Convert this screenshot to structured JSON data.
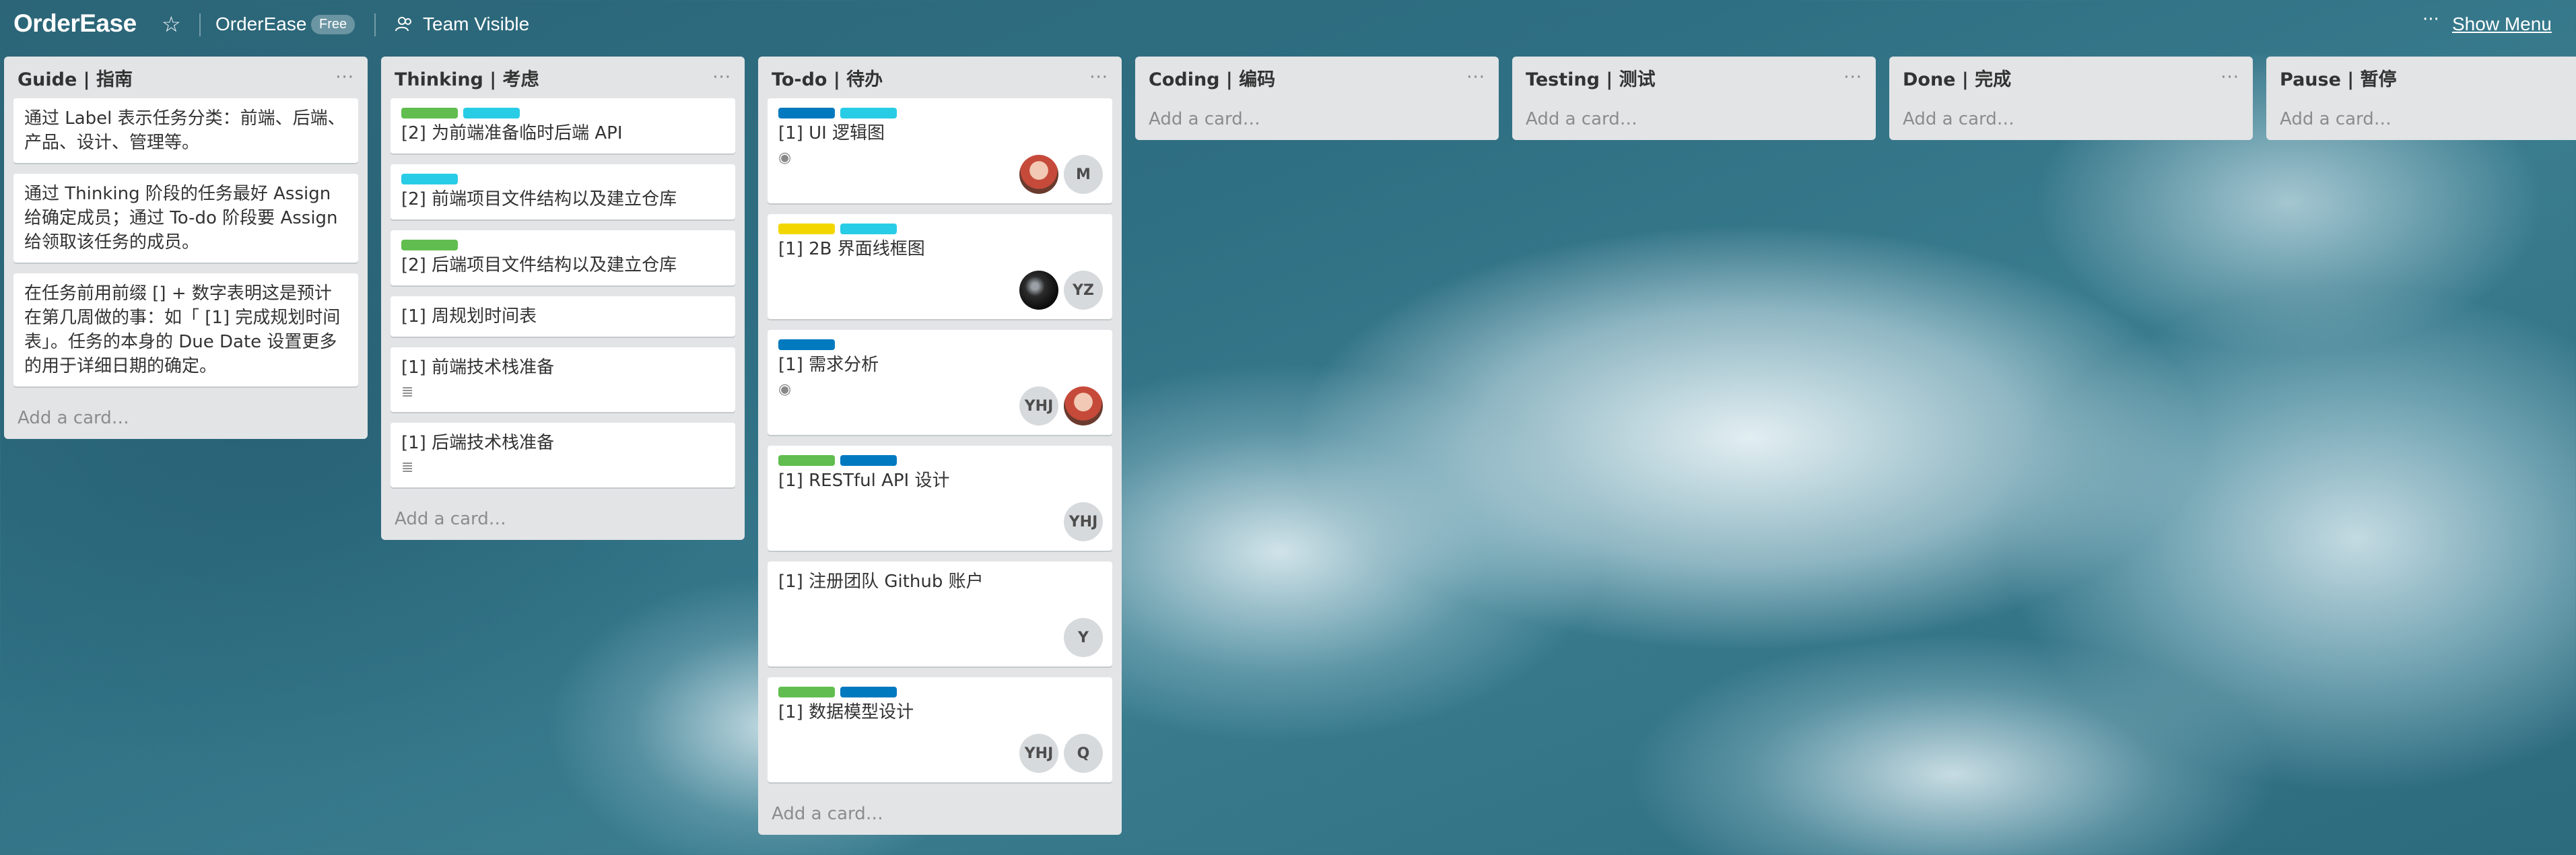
{
  "header": {
    "brand": "OrderEase",
    "org_name": "OrderEase",
    "org_badge": "Free",
    "team_visibility": "Team Visible",
    "menu_dots": "···",
    "show_menu": "Show Menu"
  },
  "colors": {
    "green": "#61bd4f",
    "cyan": "#29cce5",
    "blue": "#0079bf",
    "yellow": "#f2d600",
    "list_bg": "#e2e4e6"
  },
  "lists": [
    {
      "title": "Guide | 指南",
      "menu": "···",
      "add_card": "Add a card…",
      "cards": [
        {
          "text": "通过 Label 表示任务分类：前端、后端、产品、设计、管理等。"
        },
        {
          "text": "通过 Thinking 阶段的任务最好 Assign 给确定成员；通过 To-do 阶段要 Assign 给领取该任务的成员。"
        },
        {
          "text": "在任务前用前缀 [] + 数字表明这是预计在第几周做的事：如「 [1] 完成规划时间表」。任务的本身的 Due Date 设置更多的用于详细日期的确定。"
        }
      ]
    },
    {
      "title": "Thinking | 考虑",
      "menu": "···",
      "add_card": "Add a card…",
      "cards": [
        {
          "text": "[2] 为前端准备临时后端 API",
          "labels": [
            "green",
            "cyan"
          ]
        },
        {
          "text": "[2] 前端项目文件结构以及建立仓库",
          "labels": [
            "cyan"
          ]
        },
        {
          "text": "[2] 后端项目文件结构以及建立仓库",
          "labels": [
            "green"
          ]
        },
        {
          "text": "[1] 周规划时间表"
        },
        {
          "text": "[1] 前端技术栈准备",
          "badge": "description-icon"
        },
        {
          "text": "[1] 后端技术栈准备",
          "badge": "description-icon"
        }
      ]
    },
    {
      "title": "To-do | 待办",
      "menu": "···",
      "add_card": "Add a card…",
      "cards": [
        {
          "text": "[1] UI 逻辑图",
          "labels": [
            "blue",
            "cyan"
          ],
          "badge": "eye-icon",
          "members": [
            "photo-red",
            "M"
          ]
        },
        {
          "text": "[1] 2B 界面线框图",
          "labels": [
            "yellow",
            "cyan"
          ],
          "members": [
            "photo-dark",
            "YZ"
          ]
        },
        {
          "text": "[1] 需求分析",
          "labels": [
            "blue"
          ],
          "badge": "eye-icon",
          "members": [
            "YHJ",
            "photo-red"
          ]
        },
        {
          "text": "[1] RESTful API 设计",
          "labels": [
            "green",
            "blue"
          ],
          "members": [
            "YHJ"
          ]
        },
        {
          "text": "[1] 注册团队 Github 账户",
          "members": [
            "Y"
          ]
        },
        {
          "text": "[1] 数据模型设计",
          "labels": [
            "green",
            "blue"
          ],
          "members": [
            "YHJ",
            "Q"
          ]
        }
      ]
    },
    {
      "title": "Coding | 编码",
      "menu": "···",
      "add_card": "Add a card…",
      "cards": []
    },
    {
      "title": "Testing | 测试",
      "menu": "···",
      "add_card": "Add a card…",
      "cards": []
    },
    {
      "title": "Done | 完成",
      "menu": "···",
      "add_card": "Add a card…",
      "cards": []
    },
    {
      "title": "Pause | 暂停",
      "menu": "···",
      "add_card": "Add a card…",
      "cards": []
    }
  ]
}
